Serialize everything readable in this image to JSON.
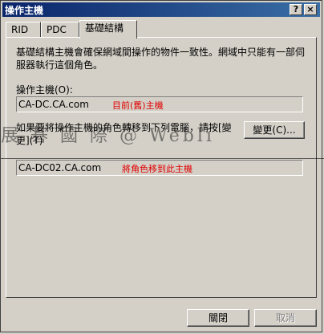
{
  "window": {
    "title": "操作主機",
    "help_label": "?",
    "close_label": "×"
  },
  "tabs": [
    {
      "label": "RID",
      "active": false
    },
    {
      "label": "PDC",
      "active": false
    },
    {
      "label": "基礎結構",
      "active": true
    }
  ],
  "panel": {
    "description": "基礎結構主機會確保網域間操作的物件一致性。網域中只能有一部伺服器執行這個角色。",
    "operations_master_label": "操作主機(O):",
    "operations_master_value": "CA-DC.CA.com",
    "current_master_note": "目前(舊)主機",
    "transfer_instruction": "如果要將操作主機的角色轉移到下列電腦，請按[變更](T)",
    "change_button": "變更(C)...",
    "target_value": "CA-DC02.CA.com",
    "target_note": "將角色移到此主機"
  },
  "watermark": "展  碁  國  際  @  Webli",
  "footer": {
    "close_button": "關閉",
    "cancel_button": "取消"
  }
}
